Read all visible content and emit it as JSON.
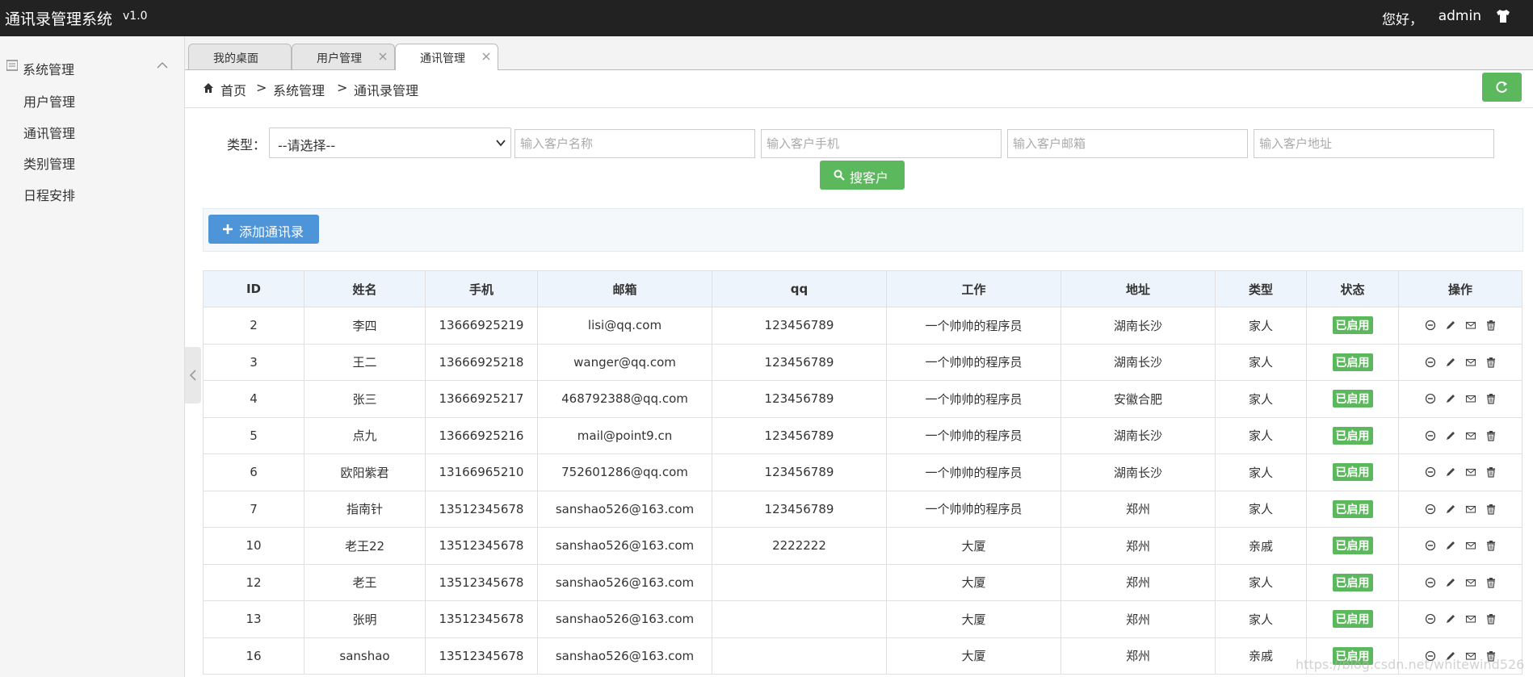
{
  "header": {
    "title": "通讯录管理系统",
    "version": "v1.0",
    "greeting": "您好，",
    "username": "admin"
  },
  "sidebar": {
    "group_label": "系统管理",
    "items": [
      {
        "label": "用户管理"
      },
      {
        "label": "通讯管理"
      },
      {
        "label": "类别管理"
      },
      {
        "label": "日程安排"
      }
    ]
  },
  "tabs": [
    {
      "label": "我的桌面"
    },
    {
      "label": "用户管理"
    },
    {
      "label": "通讯管理"
    }
  ],
  "breadcrumb": {
    "home": "首页",
    "sep": ">",
    "level2": "系统管理",
    "level3": "通讯录管理"
  },
  "search": {
    "type_label": "类型：",
    "type_value": "--请选择--",
    "name_placeholder": "输入客户名称",
    "phone_placeholder": "输入客户手机",
    "email_placeholder": "输入客户邮箱",
    "address_placeholder": "输入客户地址",
    "button_label": "搜客户"
  },
  "toolbar": {
    "add_label": "添加通讯录"
  },
  "table": {
    "headers": [
      "ID",
      "姓名",
      "手机",
      "邮箱",
      "qq",
      "工作",
      "地址",
      "类型",
      "状态",
      "操作"
    ],
    "rows": [
      {
        "id": "2",
        "name": "李四",
        "phone": "13666925219",
        "email": "lisi@qq.com",
        "qq": "123456789",
        "job": "一个帅帅的程序员",
        "address": "湖南长沙",
        "type": "家人",
        "status": "已启用"
      },
      {
        "id": "3",
        "name": "王二",
        "phone": "13666925218",
        "email": "wanger@qq.com",
        "qq": "123456789",
        "job": "一个帅帅的程序员",
        "address": "湖南长沙",
        "type": "家人",
        "status": "已启用"
      },
      {
        "id": "4",
        "name": "张三",
        "phone": "13666925217",
        "email": "468792388@qq.com",
        "qq": "123456789",
        "job": "一个帅帅的程序员",
        "address": "安徽合肥",
        "type": "家人",
        "status": "已启用"
      },
      {
        "id": "5",
        "name": "点九",
        "phone": "13666925216",
        "email": "mail@point9.cn",
        "qq": "123456789",
        "job": "一个帅帅的程序员",
        "address": "湖南长沙",
        "type": "家人",
        "status": "已启用"
      },
      {
        "id": "6",
        "name": "欧阳紫君",
        "phone": "13166965210",
        "email": "752601286@qq.com",
        "qq": "123456789",
        "job": "一个帅帅的程序员",
        "address": "湖南长沙",
        "type": "家人",
        "status": "已启用"
      },
      {
        "id": "7",
        "name": "指南针",
        "phone": "13512345678",
        "email": "sanshao526@163.com",
        "qq": "123456789",
        "job": "一个帅帅的程序员",
        "address": "郑州",
        "type": "家人",
        "status": "已启用"
      },
      {
        "id": "10",
        "name": "老王22",
        "phone": "13512345678",
        "email": "sanshao526@163.com",
        "qq": "2222222",
        "job": "大厦",
        "address": "郑州",
        "type": "亲戚",
        "status": "已启用"
      },
      {
        "id": "12",
        "name": "老王",
        "phone": "13512345678",
        "email": "sanshao526@163.com",
        "qq": "",
        "job": "大厦",
        "address": "郑州",
        "type": "家人",
        "status": "已启用"
      },
      {
        "id": "13",
        "name": "张明",
        "phone": "13512345678",
        "email": "sanshao526@163.com",
        "qq": "",
        "job": "大厦",
        "address": "郑州",
        "type": "家人",
        "status": "已启用"
      },
      {
        "id": "16",
        "name": "sanshao",
        "phone": "13512345678",
        "email": "sanshao526@163.com",
        "qq": "",
        "job": "大厦",
        "address": "郑州",
        "type": "亲戚",
        "status": "已启用"
      }
    ]
  },
  "watermark": "https://blog.csdn.net/whitewind526",
  "colors": {
    "topbar": "#222222",
    "success": "#5cb85c",
    "primary": "#4d95d8"
  }
}
